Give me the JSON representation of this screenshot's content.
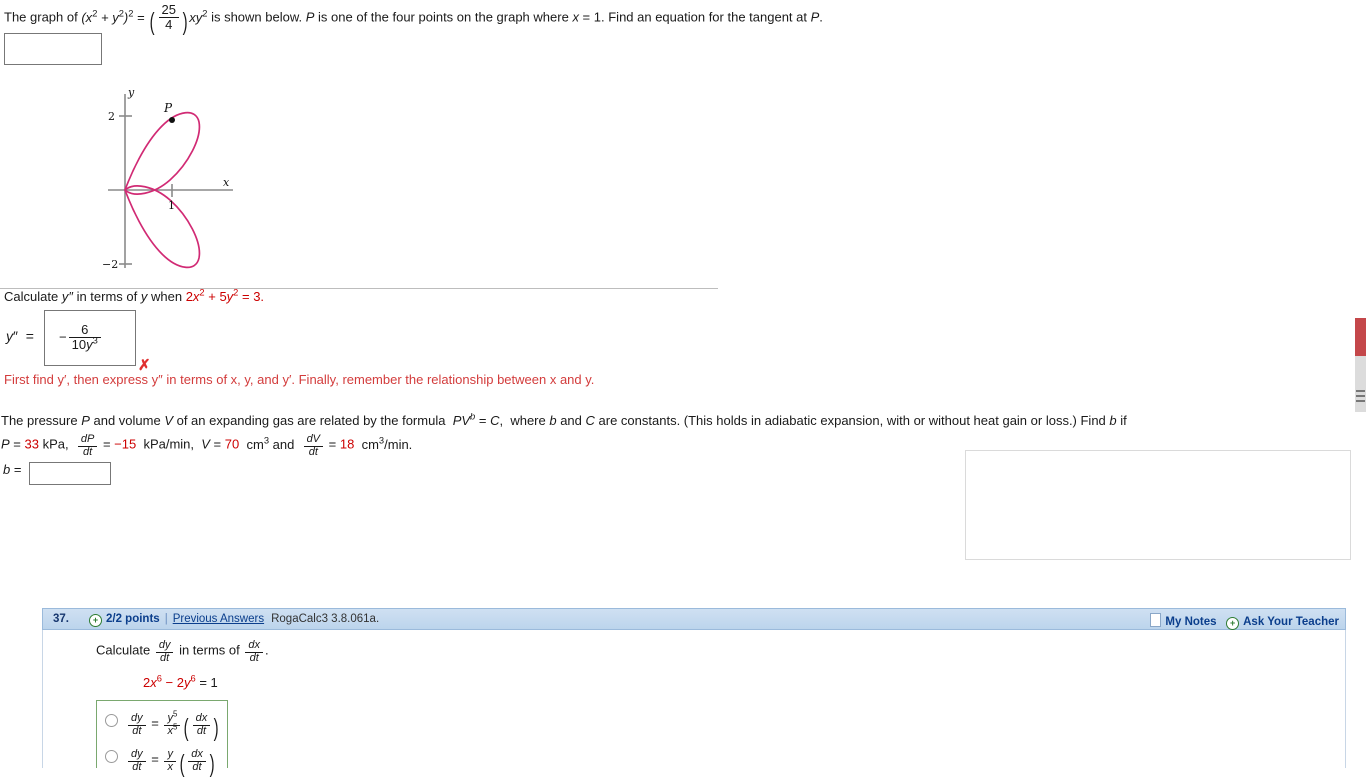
{
  "question_tangent": {
    "text_before": "The graph of",
    "equation_lhs": "(x² + y²)²  =  (25/4) xy²",
    "text_middle": "is shown below.",
    "text_p": "P is one of the four points on the graph where",
    "condition": "x = 1.",
    "text_after": "Find an equation for the tangent at P.",
    "answer_value": ""
  },
  "graph": {
    "curve_color": "#d12a74",
    "axis_color": "#808080",
    "x_axis_label": "x",
    "y_axis_label": "y",
    "y_tick_top": "2",
    "y_tick_bottom": "−2",
    "x_tick": "1",
    "point_label": "P"
  },
  "question_ypp": {
    "prompt_a": "Calculate",
    "prompt_b": "y″",
    "prompt_c": "in terms of y when",
    "equation": "2x² + 5y² = 3.",
    "answer_lhs": "y″  =",
    "answer_numerator": "6",
    "answer_denominator": "10y³",
    "answer_sign": "−",
    "mark": "✗",
    "mark_color": "#e03030",
    "hint": "First find  y′,  then express  y″  in terms of  x, y,  and  y′.  Finally, remember the relationship between  x  and  y.",
    "hint_color": "#d33c3c"
  },
  "question_gas": {
    "line1_a": "The pressure P and volume V of an expanding gas are related by the formula",
    "line1_formula": "PVᵇ = C,",
    "line1_b": "where b and C are constants. (This holds in adiabatic expansion, with or without heat gain or loss.) Find b if",
    "P_label": "P =",
    "P_value": "33",
    "P_unit": "kPa,",
    "dPdt_num": "dP",
    "dPdt_den": "dt",
    "dPdt_eq": "=",
    "dPdt_value": "−15",
    "dPdt_unit": "kPa/min,",
    "V_label": "V =",
    "V_value": "70",
    "V_unit": "cm³ and",
    "dVdt_num": "dV",
    "dVdt_den": "dt",
    "dVdt_eq": "=",
    "dVdt_value": "18",
    "dVdt_unit": "cm³/min.",
    "answer_label": "b =",
    "answer_value": ""
  },
  "question_37": {
    "number": "37.",
    "points": "2/2 points",
    "separator": "|",
    "previous_answers": "Previous Answers",
    "code": "RogaCalc3 3.8.061a.",
    "my_notes": "My Notes",
    "ask_teacher": "Ask Your Teacher",
    "plus_glyph": "+",
    "prompt_a": "Calculate",
    "prompt_frac1_num": "dy",
    "prompt_frac1_den": "dt",
    "prompt_b": "in terms of",
    "prompt_frac2_num": "dx",
    "prompt_frac2_den": "dt",
    "prompt_c": ".",
    "equation_red": "2x⁶ − 2y⁶",
    "equation_black": "= 1",
    "options": [
      {
        "lhs_num": "dy",
        "lhs_den": "dt",
        "eq": "=",
        "coef_num": "y⁵",
        "coef_den": "x⁵",
        "paren_num": "dx",
        "paren_den": "dt",
        "selected": false
      },
      {
        "lhs_num": "dy",
        "lhs_den": "dt",
        "eq": "=",
        "coef_num": "y",
        "coef_den": "x",
        "paren_num": "dx",
        "paren_den": "dt",
        "selected": false
      }
    ]
  },
  "scrollbar": {
    "thumb_color": "#c4474a",
    "track_color": "#f1f1f1"
  }
}
